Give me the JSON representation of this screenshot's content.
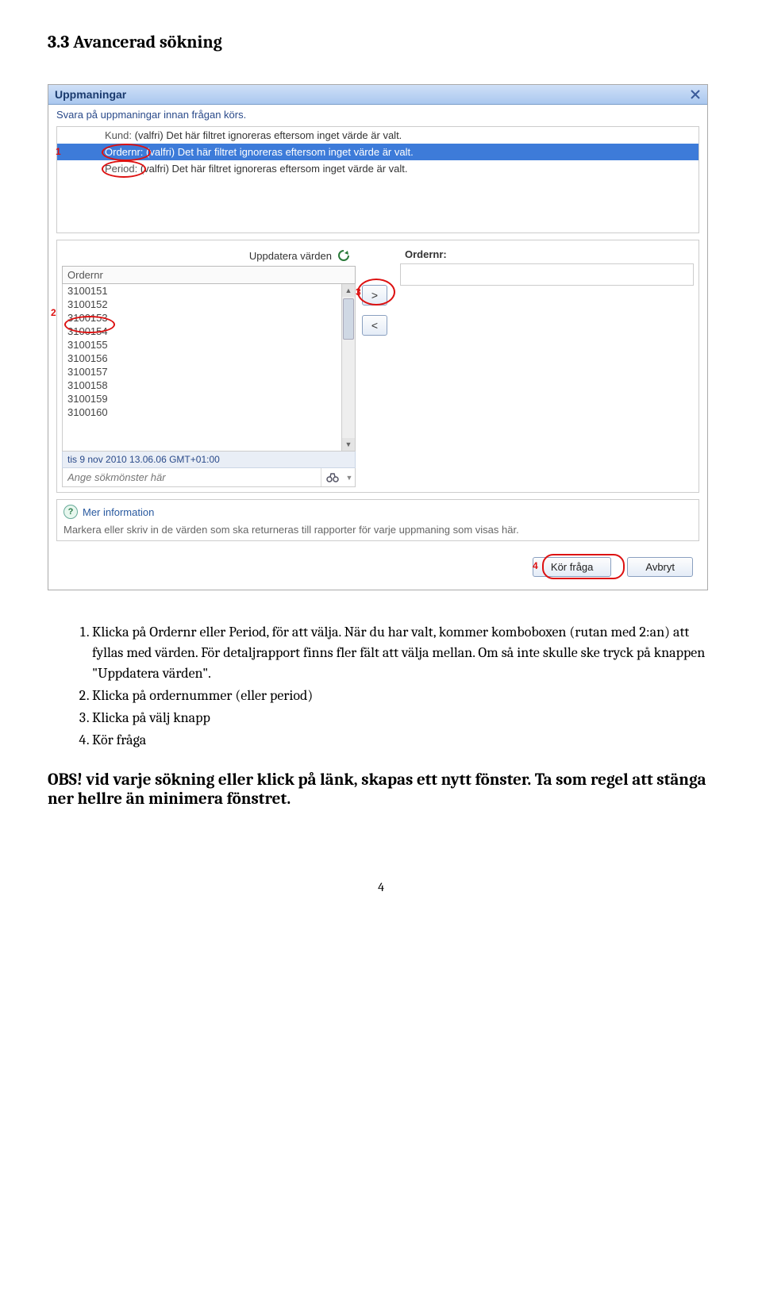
{
  "heading": "3.3 Avancerad sökning",
  "dialog": {
    "title": "Uppmaningar",
    "subtitle": "Svara på uppmaningar innan frågan körs.",
    "filters": {
      "row0": {
        "label": "Kund:",
        "text": "(valfri) Det här filtret ignoreras eftersom inget värde är valt."
      },
      "row1": {
        "label": "Ordernr:",
        "text": "(valfri) Det här filtret ignoreras eftersom inget värde är valt."
      },
      "row2": {
        "label": "Period:",
        "text": "(valfri) Det här filtret ignoreras eftersom inget värde är valt."
      }
    },
    "refresh_label": "Uppdatera värden",
    "list_header": "Ordernr",
    "list_items": [
      "3100151",
      "3100152",
      "3100153",
      "3100154",
      "3100155",
      "3100156",
      "3100157",
      "3100158",
      "3100159",
      "3100160"
    ],
    "timestamp": "tis 9 nov 2010 13.06.06 GMT+01:00",
    "search_placeholder": "Ange sökmönster här",
    "right_header": "Ordernr:",
    "move_right": ">",
    "move_left": "<",
    "more_info": "Mer information",
    "info_text": "Markera eller skriv in de värden som ska returneras till rapporter för varje uppmaning som visas här.",
    "run_btn": "Kör fråga",
    "cancel_btn": "Avbryt"
  },
  "annot": {
    "n1": "1",
    "n2": "2",
    "n3": "3",
    "n4": "4"
  },
  "instructions": {
    "i1": "Klicka på Ordernr eller Period, för att välja. När du har valt, kommer komboboxen (rutan med 2:an) att fyllas med värden. För detaljrapport finns fler fält att välja mellan. Om så inte skulle ske tryck på knappen \"Uppdatera värden\".",
    "i2": "Klicka på ordernummer (eller period)",
    "i3": "Klicka på välj knapp",
    "i4": "Kör fråga"
  },
  "obs": "OBS! vid varje sökning eller klick på länk, skapas ett nytt fönster. Ta som regel att stänga ner hellre än minimera fönstret.",
  "page_number": "4"
}
